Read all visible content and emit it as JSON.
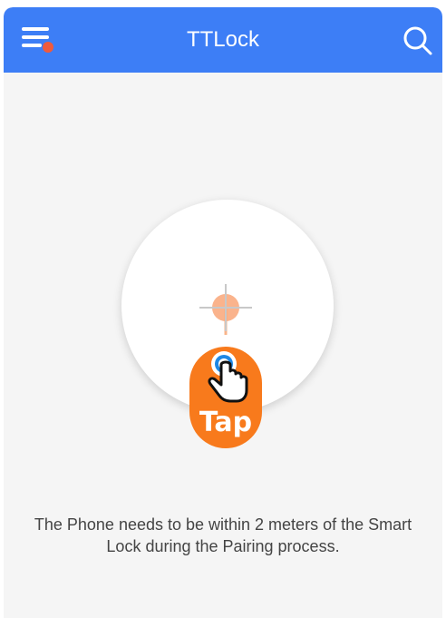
{
  "appbar": {
    "title": "TTLock",
    "menu_icon": "menu-icon",
    "notification_dot_color": "#f05a3c",
    "search_icon": "search-icon",
    "background_color": "#3d7ef6"
  },
  "illustration": {
    "tap_label": "Tap",
    "accent_color": "#f87a1c",
    "hand_icon": "hand-tap-icon",
    "target_icon": "crosshair-target-icon"
  },
  "hint": {
    "text": "The Phone needs to be within 2 meters of the Smart Lock during the Pairing process."
  }
}
